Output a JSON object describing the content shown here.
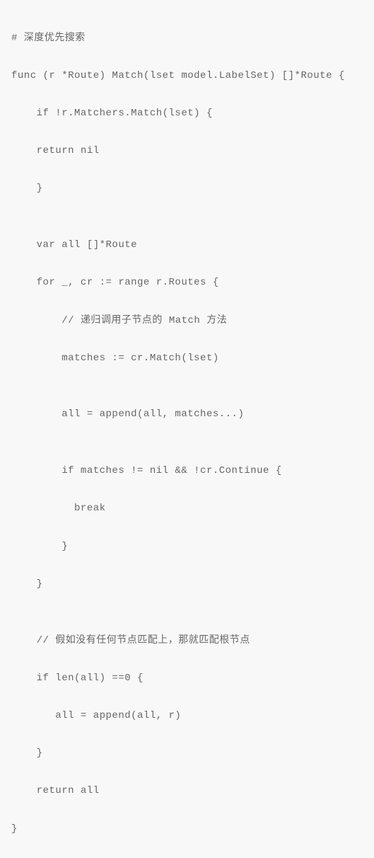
{
  "code": {
    "l1": "# 深度优先搜索",
    "l2": "func (r *Route) Match(lset model.LabelSet) []*Route {",
    "l3": "    if !r.Matchers.Match(lset) {",
    "l4": "    return nil",
    "l5": "    }",
    "l6": "",
    "l7": "    var all []*Route",
    "l8": "    for _, cr := range r.Routes {",
    "l9": "        // 递归调用子节点的 Match 方法",
    "l10": "        matches := cr.Match(lset)",
    "l11": "",
    "l12": "        all = append(all, matches...)",
    "l13": "",
    "l14": "        if matches != nil && !cr.Continue {",
    "l15": "          break",
    "l16": "        }",
    "l17": "    }",
    "l18": "",
    "l19": "    // 假如没有任何节点匹配上，那就匹配根节点",
    "l20": "    if len(all) ==0 {",
    "l21": "       all = append(all, r)",
    "l22": "    }",
    "l23": "    return all",
    "l24": "}"
  }
}
